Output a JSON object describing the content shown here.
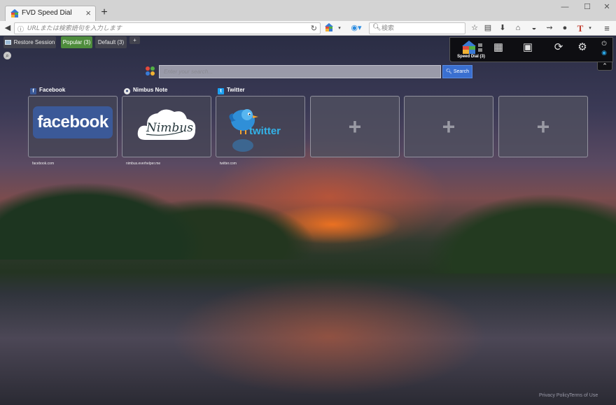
{
  "browser": {
    "tab_title": "FVD Speed Dial",
    "new_tab": "+",
    "url_placeholder": "URLまたは検索語句を入力します",
    "search_placeholder": "検索",
    "window_controls": {
      "minimize": "—",
      "maximize": "☐",
      "close": "✕"
    }
  },
  "speed_dial": {
    "group_tabs": [
      {
        "label": "Restore Session"
      },
      {
        "label": "Popular (3)",
        "active": true
      },
      {
        "label": "Default (3)"
      },
      {
        "label": "+"
      }
    ],
    "search": {
      "placeholder": "Enter your search...",
      "button": "Search"
    },
    "dials": [
      {
        "title": "Facebook",
        "url": "facebook.com",
        "icon": "facebook-icon"
      },
      {
        "title": "Nimbus Note",
        "url": "nimbus.everhelper.me",
        "icon": "nimbus-icon",
        "logo_text": "Nimbus"
      },
      {
        "title": "Twitter",
        "url": "twitter.com",
        "icon": "twitter-icon",
        "logo_text": "twitter"
      }
    ],
    "facebook_logo_text": "facebook",
    "empty_dial_symbol": "+",
    "footer": {
      "privacy": "Privacy Policy",
      "terms": "Terms of Use"
    }
  },
  "toolbar_panel": {
    "home_label": "Speed Dial (3)"
  },
  "colors": {
    "accent_green": "#4e8c3c",
    "search_button": "#3a6fd0",
    "facebook_blue": "#3b5998"
  }
}
